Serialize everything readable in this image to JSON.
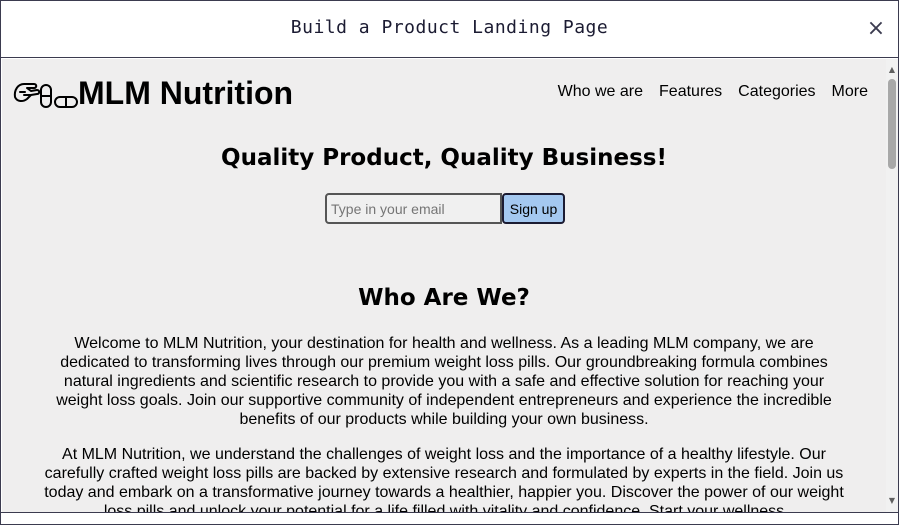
{
  "modal": {
    "title": "Build a Product Landing Page",
    "close_symbol": "×"
  },
  "site": {
    "brand": "MLM Nutrition",
    "logo_icon": "pills-hand-icon",
    "nav": [
      {
        "label": "Who we are"
      },
      {
        "label": "Features"
      },
      {
        "label": "Categories"
      },
      {
        "label": "More"
      }
    ]
  },
  "hero": {
    "title": "Quality Product, Quality Business!",
    "email_placeholder": "Type in your email",
    "signup_label": "Sign up"
  },
  "who": {
    "title": "Who Are We?",
    "paragraphs": [
      "Welcome to MLM Nutrition, your destination for health and wellness. As a leading MLM company, we are dedicated to transforming lives through our premium weight loss pills. Our groundbreaking formula combines natural ingredients and scientific research to provide you with a safe and effective solution for reaching your weight loss goals. Join our supportive community of independent entrepreneurs and experience the incredible benefits of our products while building your own business.",
      "At MLM Nutrition, we understand the challenges of weight loss and the importance of a healthy lifestyle. Our carefully crafted weight loss pills are backed by extensive research and formulated by experts in the field. Join us today and embark on a transformative journey towards a healthier, happier you. Discover the power of our weight loss pills and unlock your potential for a life filled with vitality and confidence. Start your wellness"
    ]
  },
  "scrollbar": {
    "up_symbol": "▲",
    "down_symbol": "▼"
  },
  "colors": {
    "page_bg": "#efeeee",
    "button_bg": "#a4c8f0",
    "border": "#3b3b4f"
  }
}
